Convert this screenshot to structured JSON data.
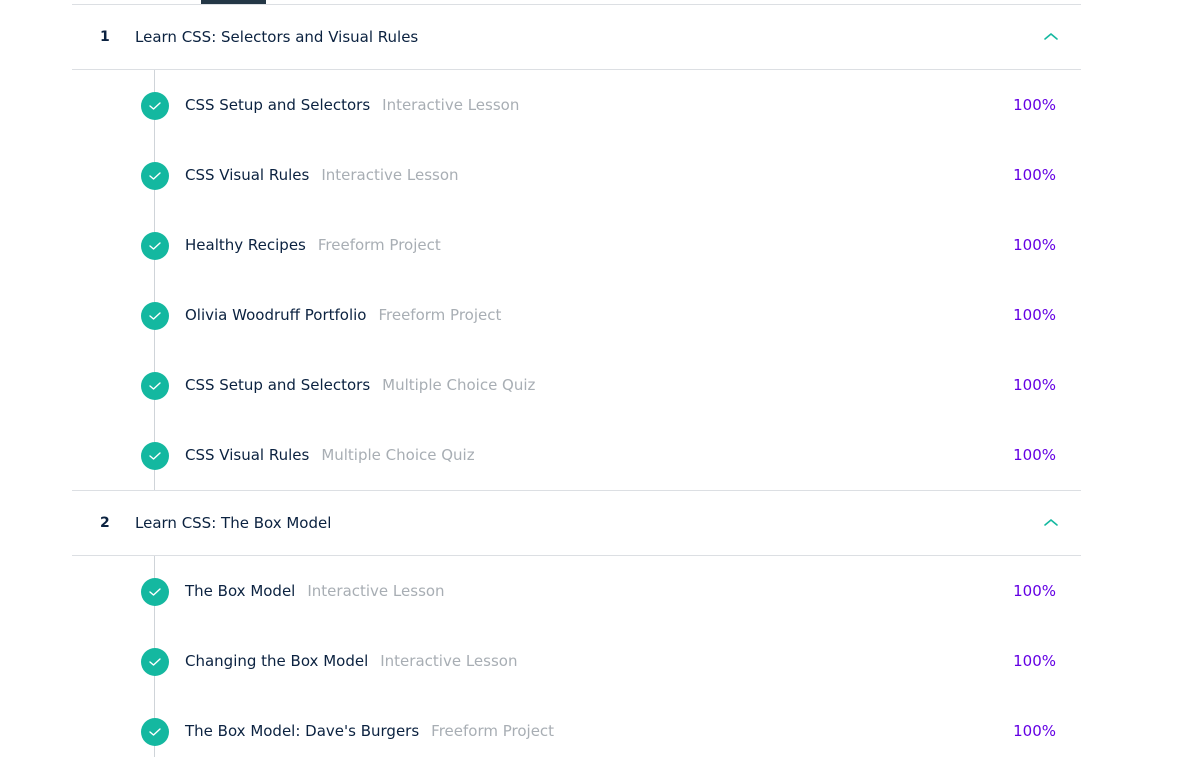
{
  "colors": {
    "accent_teal": "#14b8a0",
    "progress_purple": "#6400e4",
    "text_dark": "#0b2240",
    "text_muted": "#a8aeb4"
  },
  "modules": [
    {
      "number": "1",
      "title": "Learn CSS: Selectors and Visual Rules",
      "toggle_icon": "chevron-up-icon",
      "lessons": [
        {
          "title": "CSS Setup and Selectors",
          "type": "Interactive Lesson",
          "progress": "100%"
        },
        {
          "title": "CSS Visual Rules",
          "type": "Interactive Lesson",
          "progress": "100%"
        },
        {
          "title": "Healthy Recipes",
          "type": "Freeform Project",
          "progress": "100%"
        },
        {
          "title": "Olivia Woodruff Portfolio",
          "type": "Freeform Project",
          "progress": "100%"
        },
        {
          "title": "CSS Setup and Selectors",
          "type": "Multiple Choice Quiz",
          "progress": "100%"
        },
        {
          "title": "CSS Visual Rules",
          "type": "Multiple Choice Quiz",
          "progress": "100%"
        }
      ]
    },
    {
      "number": "2",
      "title": "Learn CSS: The Box Model",
      "toggle_icon": "chevron-up-icon",
      "lessons": [
        {
          "title": "The Box Model",
          "type": "Interactive Lesson",
          "progress": "100%"
        },
        {
          "title": "Changing the Box Model",
          "type": "Interactive Lesson",
          "progress": "100%"
        },
        {
          "title": "The Box Model: Dave's Burgers",
          "type": "Freeform Project",
          "progress": "100%"
        }
      ]
    }
  ]
}
